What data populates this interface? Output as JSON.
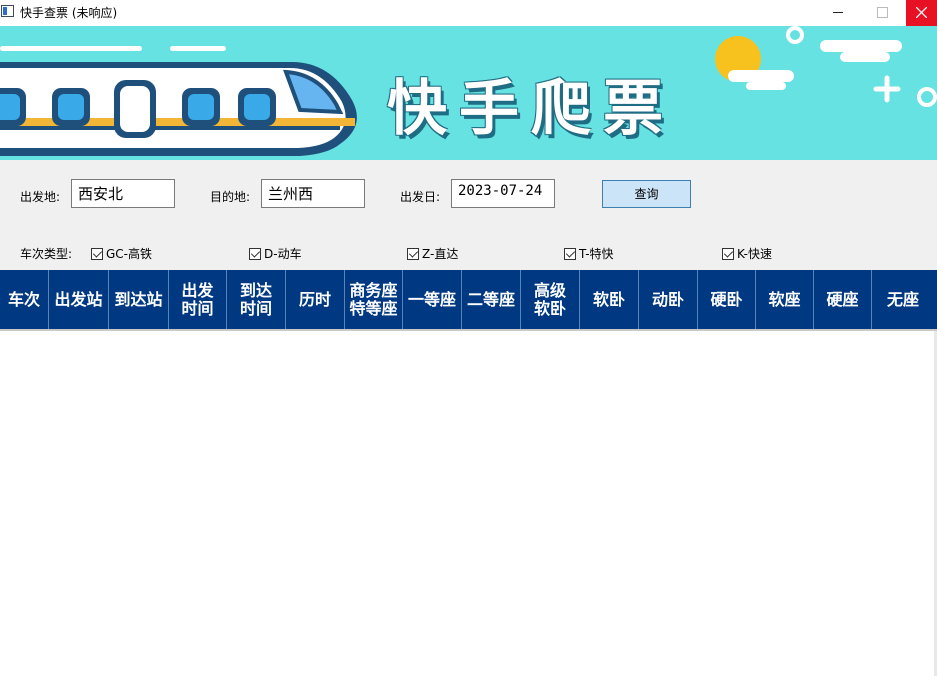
{
  "window": {
    "title": "快手查票 (未响应)"
  },
  "banner": {
    "title": "快手爬票"
  },
  "form": {
    "from_label": "出发地:",
    "from_value": "西安北",
    "to_label": "目的地:",
    "to_value": "兰州西",
    "date_label": "出发日:",
    "date_value": "2023-07-24",
    "query_label": "查询",
    "train_type_label": "车次类型:",
    "train_types": [
      {
        "label": "GC-高铁",
        "checked": true
      },
      {
        "label": "D-动车",
        "checked": true
      },
      {
        "label": "Z-直达",
        "checked": true
      },
      {
        "label": "T-特快",
        "checked": true
      },
      {
        "label": "K-快速",
        "checked": true
      }
    ]
  },
  "table": {
    "columns": [
      "车次",
      "出发站",
      "到达站",
      "出发\n时间",
      "到达\n时间",
      "历时",
      "商务座\n特等座",
      "一等座",
      "二等座",
      "高级\n软卧",
      "软卧",
      "动卧",
      "硬卧",
      "软座",
      "硬座",
      "无座"
    ],
    "rows": []
  },
  "colors": {
    "banner_bg": "#66e2e2",
    "header_bg": "#003882",
    "close_bg": "#e81123",
    "button_bg": "#cce4f7"
  }
}
